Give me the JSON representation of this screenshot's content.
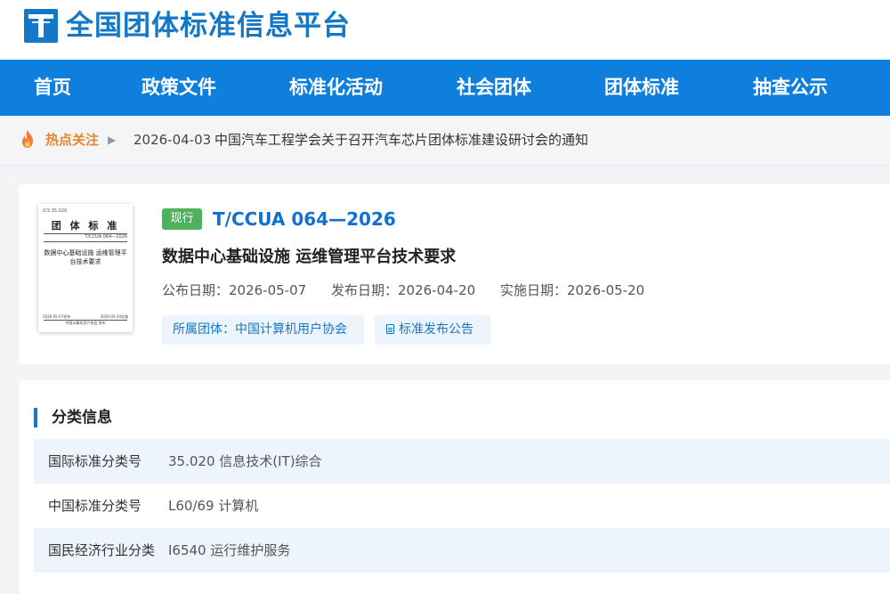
{
  "header": {
    "site_title": "全国团体标准信息平台",
    "logo_icon": "platform-logo-icon",
    "brand_color": "#1478c7"
  },
  "nav": {
    "color": "#0f7fde",
    "items": [
      {
        "label": "首页"
      },
      {
        "label": "政策文件"
      },
      {
        "label": "标准化活动"
      },
      {
        "label": "社会团体"
      },
      {
        "label": "团体标准"
      },
      {
        "label": "抽查公示"
      }
    ]
  },
  "hot": {
    "icon": "flame-icon",
    "label": "热点关注",
    "arrow": "▶",
    "date": "2026-04-03",
    "title": "中国汽车工程学会关于召开汽车芯片团体标准建设研讨会的通知"
  },
  "standard": {
    "cover": {
      "ics": "ICS 35.020",
      "title": "团 体 标 准",
      "code": "T/CCUA 064—2026",
      "name": "数据中心基础设施 运维管理平台技术要求",
      "pub_date": "2026-05-07发布",
      "impl_date": "2026-05-20实施",
      "org": "中国计算机用户协会 发布"
    },
    "status": "现行",
    "status_color": "#4db25b",
    "code": "T/CCUA 064—2026",
    "name": "数据中心基础设施 运维管理平台技术要求",
    "dates": [
      {
        "label": "公布日期：2026-05-07"
      },
      {
        "label": "发布日期：2026-04-20"
      },
      {
        "label": "实施日期：2026-05-20"
      }
    ],
    "org_label": "所属团体：中国计算机用户协会",
    "notice_label": "标准发布公告",
    "notice_icon": "document-icon"
  },
  "classification": {
    "title": "分类信息",
    "rows": [
      {
        "label": "国际标准分类号",
        "value": "35.020 信息技术(IT)综合"
      },
      {
        "label": "中国标准分类号",
        "value": "L60/69 计算机"
      },
      {
        "label": "国民经济行业分类",
        "value": "I6540 运行维护服务"
      }
    ]
  }
}
